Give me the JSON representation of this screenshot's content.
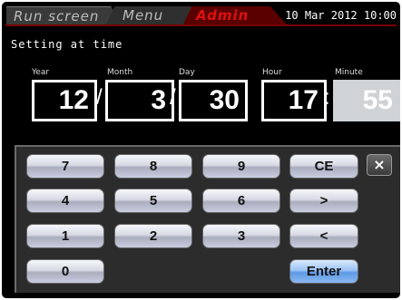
{
  "tabs": [
    {
      "label": "Run screen"
    },
    {
      "label": "Menu"
    },
    {
      "label": "Admin"
    }
  ],
  "datetime": "10 Mar 2012 10:00",
  "panel": {
    "title": "Setting at time",
    "fields": [
      {
        "label": "Year",
        "value": "12"
      },
      {
        "label": "Month",
        "value": "3"
      },
      {
        "label": "Day",
        "value": "30"
      },
      {
        "label": "Hour",
        "value": "17"
      },
      {
        "label": "Minute",
        "value": "55"
      }
    ],
    "separators": [
      "/",
      "/",
      ":"
    ]
  },
  "keypad": {
    "keys": [
      "7",
      "8",
      "9",
      "CE",
      "4",
      "5",
      "6",
      ">",
      "1",
      "2",
      "3",
      "<",
      "0",
      "Enter"
    ],
    "close_label": "×"
  }
}
